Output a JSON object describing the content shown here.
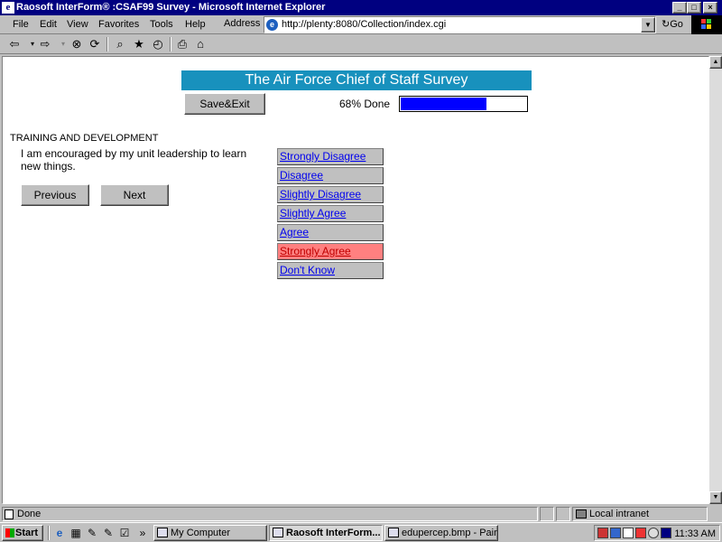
{
  "window": {
    "title": "Raosoft InterForm® :CSAF99 Survey - Microsoft Internet Explorer",
    "min": "_",
    "max": "□",
    "close": "×"
  },
  "menu": {
    "items": [
      "File",
      "Edit",
      "View",
      "Favorites",
      "Tools",
      "Help"
    ],
    "address_label": "Address",
    "address_value": "http://plenty:8080/Collection/index.cgi",
    "go_label": "Go"
  },
  "toolbar": {
    "icons": [
      "back-icon",
      "forward-icon",
      "stop-icon",
      "refresh-icon",
      "search-icon",
      "favorites-icon",
      "history-icon",
      "print-icon",
      "home-icon"
    ]
  },
  "survey": {
    "title": "The Air Force Chief of Staff Survey",
    "save_exit": "Save&Exit",
    "progress_label": "68% Done",
    "progress": 0.68,
    "section": "TRAINING AND DEVELOPMENT",
    "question": "I am encouraged by my unit leadership to learn new things.",
    "previous": "Previous",
    "next": "Next",
    "answers": [
      {
        "label": "Strongly Disagree",
        "selected": false
      },
      {
        "label": "Disagree",
        "selected": false
      },
      {
        "label": "Slightly Disagree",
        "selected": false
      },
      {
        "label": "Slightly Agree",
        "selected": false
      },
      {
        "label": "Agree",
        "selected": false
      },
      {
        "label": "Strongly Agree",
        "selected": true
      },
      {
        "label": "Don't Know",
        "selected": false
      }
    ]
  },
  "status": {
    "text": "Done",
    "zone": "Local intranet"
  },
  "taskbar": {
    "start": "Start",
    "more": "»",
    "tasks": [
      {
        "label": "My Computer",
        "active": false
      },
      {
        "label": "Raosoft InterForm...",
        "active": true
      },
      {
        "label": "edupercep.bmp - Paint",
        "active": false
      }
    ],
    "clock": "11:33 AM"
  },
  "colors": {
    "title_bar": "#000080",
    "survey_header": "#1891bd",
    "progress_fill": "#0000ff",
    "selected_answer": "#ff8080"
  }
}
